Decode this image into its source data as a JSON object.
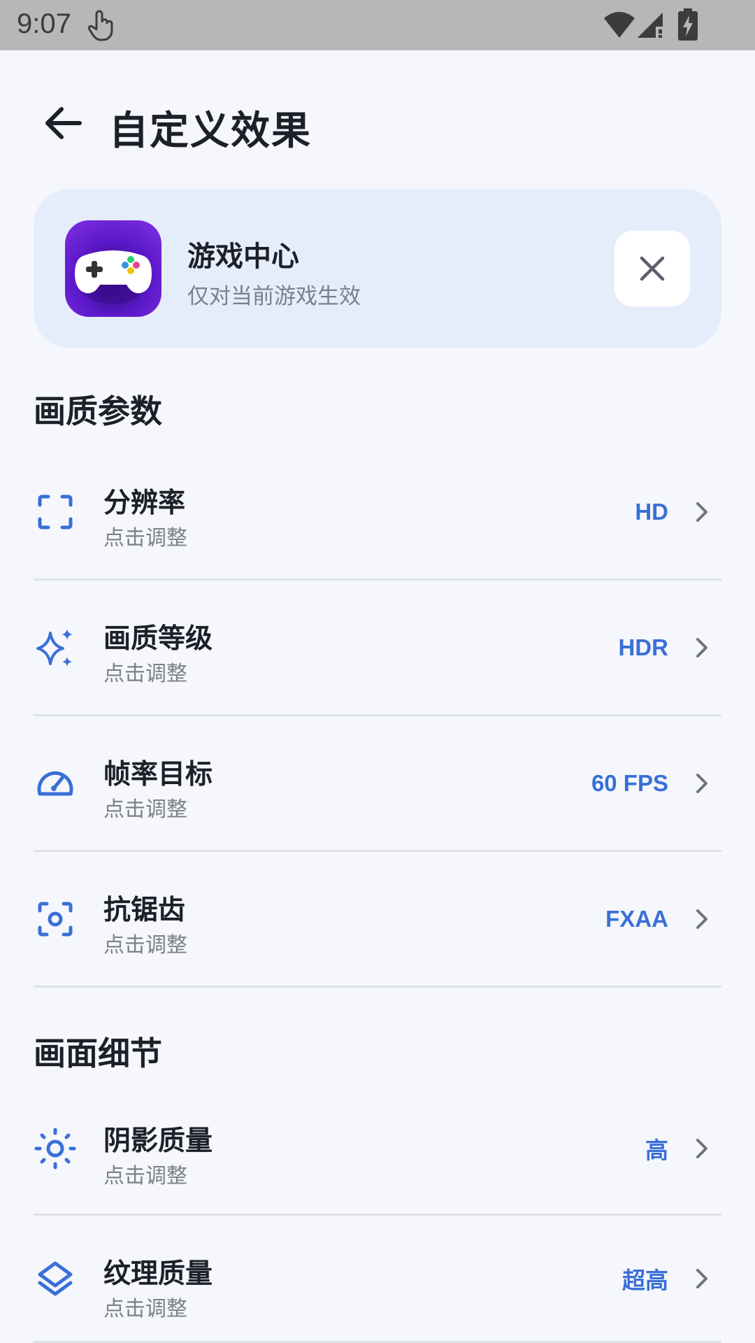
{
  "status_bar": {
    "time": "9:07"
  },
  "header": {
    "title": "自定义效果"
  },
  "app_card": {
    "name": "游戏中心",
    "subtitle": "仅对当前游戏生效"
  },
  "sections": [
    {
      "title": "画质参数",
      "items": [
        {
          "label": "分辨率",
          "hint": "点击调整",
          "value": "HD",
          "icon": "fullscreen-icon"
        },
        {
          "label": "画质等级",
          "hint": "点击调整",
          "value": "HDR",
          "icon": "sparkle-icon"
        },
        {
          "label": "帧率目标",
          "hint": "点击调整",
          "value": "60 FPS",
          "icon": "speedometer-icon"
        },
        {
          "label": "抗锯齿",
          "hint": "点击调整",
          "value": "FXAA",
          "icon": "focus-icon"
        }
      ]
    },
    {
      "title": "画面细节",
      "items": [
        {
          "label": "阴影质量",
          "hint": "点击调整",
          "value": "高",
          "icon": "sun-icon"
        },
        {
          "label": "纹理质量",
          "hint": "点击调整",
          "value": "超高",
          "icon": "layers-icon"
        }
      ]
    }
  ],
  "colors": {
    "accent": "#3a6fd8",
    "card_bg": "#e5edfb",
    "page_bg": "#f5f7fc"
  }
}
